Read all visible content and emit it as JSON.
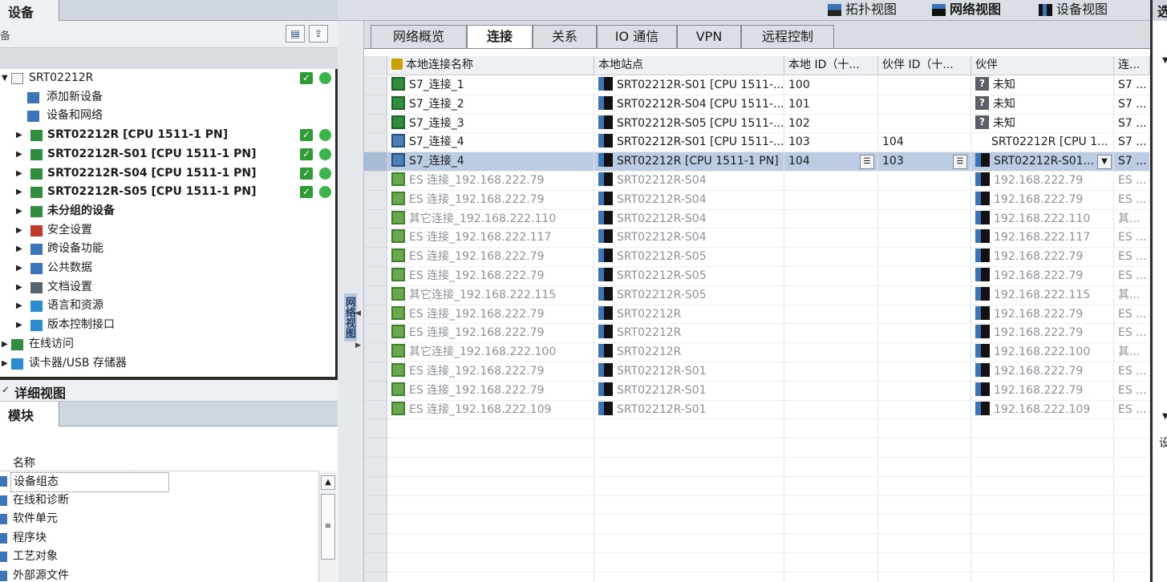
{
  "left_panel": {
    "tab_title": "设备",
    "toolbar_label": "备",
    "tree": [
      {
        "label": "SRT02212R",
        "indent": 0,
        "expanded": true,
        "bold": false,
        "status": true,
        "icon": "project-icon"
      },
      {
        "label": "添加新设备",
        "indent": 1,
        "expanded": null,
        "bold": false,
        "status": false,
        "icon": "add-device-icon"
      },
      {
        "label": "设备和网络",
        "indent": 1,
        "expanded": null,
        "bold": false,
        "status": false,
        "icon": "network-icon"
      },
      {
        "label": "SRT02212R [CPU 1511-1 PN]",
        "indent": 1,
        "expanded": false,
        "bold": true,
        "status": true,
        "icon": "plc-icon"
      },
      {
        "label": "SRT02212R-S01 [CPU 1511-1 PN]",
        "indent": 1,
        "expanded": false,
        "bold": true,
        "status": true,
        "icon": "plc-icon"
      },
      {
        "label": "SRT02212R-S04 [CPU 1511-1 PN]",
        "indent": 1,
        "expanded": false,
        "bold": true,
        "status": true,
        "icon": "plc-icon"
      },
      {
        "label": "SRT02212R-S05 [CPU 1511-1 PN]",
        "indent": 1,
        "expanded": false,
        "bold": true,
        "status": true,
        "icon": "plc-icon"
      },
      {
        "label": "未分组的设备",
        "indent": 1,
        "expanded": false,
        "bold": true,
        "status": false,
        "icon": "ungrouped-icon"
      },
      {
        "label": "安全设置",
        "indent": 1,
        "expanded": false,
        "bold": false,
        "status": false,
        "icon": "security-icon"
      },
      {
        "label": "跨设备功能",
        "indent": 1,
        "expanded": false,
        "bold": false,
        "status": false,
        "icon": "cross-device-icon"
      },
      {
        "label": "公共数据",
        "indent": 1,
        "expanded": false,
        "bold": false,
        "status": false,
        "icon": "common-data-icon"
      },
      {
        "label": "文档设置",
        "indent": 1,
        "expanded": false,
        "bold": false,
        "status": false,
        "icon": "document-icon"
      },
      {
        "label": "语言和资源",
        "indent": 1,
        "expanded": false,
        "bold": false,
        "status": false,
        "icon": "language-icon"
      },
      {
        "label": "版本控制接口",
        "indent": 1,
        "expanded": false,
        "bold": false,
        "status": false,
        "icon": "version-control-icon"
      },
      {
        "label": "在线访问",
        "indent": 0,
        "expanded": false,
        "bold": false,
        "status": false,
        "icon": "online-access-icon"
      },
      {
        "label": "读卡器/USB 存储器",
        "indent": 0,
        "expanded": false,
        "bold": false,
        "status": false,
        "icon": "card-reader-icon"
      }
    ],
    "detail_title": "详细视图",
    "detail_tab": "模块",
    "detail_column": "名称",
    "detail_rows": [
      {
        "label": "设备组态",
        "selected": true
      },
      {
        "label": "在线和诊断",
        "selected": false
      },
      {
        "label": "软件单元",
        "selected": false
      },
      {
        "label": "程序块",
        "selected": false
      },
      {
        "label": "工艺对象",
        "selected": false
      },
      {
        "label": "外部源文件",
        "selected": false
      }
    ]
  },
  "view_toolbar": {
    "topology": "拓扑视图",
    "network": "网络视图",
    "device": "设备视图"
  },
  "side_strip_label": "网络视图",
  "tabs": [
    {
      "label": "网络概览",
      "active": false
    },
    {
      "label": "连接",
      "active": true
    },
    {
      "label": "关系",
      "active": false
    },
    {
      "label": "IO 通信",
      "active": false
    },
    {
      "label": "VPN",
      "active": false
    },
    {
      "label": "远程控制",
      "active": false
    }
  ],
  "columns": [
    "本地连接名称",
    "本地站点",
    "本地 ID（十...",
    "伙伴 ID（十...",
    "伙伴",
    "连..."
  ],
  "rows": [
    {
      "name": "S7_连接_1",
      "local_station": "SRT02212R-S01 [CPU 1511-...",
      "local_id": "100",
      "partner_id": "",
      "partner": "未知",
      "conn_type": "S7 ...",
      "greyed": false,
      "selected": false,
      "icon": "s7",
      "partner_icon": "unknown"
    },
    {
      "name": "S7_连接_2",
      "local_station": "SRT02212R-S04 [CPU 1511-...",
      "local_id": "101",
      "partner_id": "",
      "partner": "未知",
      "conn_type": "S7 ...",
      "greyed": false,
      "selected": false,
      "icon": "s7",
      "partner_icon": "unknown"
    },
    {
      "name": "S7_连接_3",
      "local_station": "SRT02212R-S05 [CPU 1511-...",
      "local_id": "102",
      "partner_id": "",
      "partner": "未知",
      "conn_type": "S7 ...",
      "greyed": false,
      "selected": false,
      "icon": "s7",
      "partner_icon": "unknown"
    },
    {
      "name": "S7_连接_4",
      "local_station": "SRT02212R-S01 [CPU 1511-...",
      "local_id": "103",
      "partner_id": "104",
      "partner": "SRT02212R [CPU 1...",
      "conn_type": "S7 ...",
      "greyed": false,
      "selected": false,
      "icon": "s7vr",
      "partner_icon": "none"
    },
    {
      "name": "S7_连接_4",
      "local_station": "SRT02212R [CPU 1511-1 PN]",
      "local_id": "104",
      "partner_id": "103",
      "partner": "SRT02212R-S01...",
      "conn_type": "S7 ...",
      "greyed": false,
      "selected": true,
      "icon": "s7vr",
      "partner_icon": "cpu"
    },
    {
      "name": "ES 连接_192.168.222.79",
      "local_station": "SRT02212R-S04",
      "local_id": "",
      "partner_id": "",
      "partner": "192.168.222.79",
      "conn_type": "ES ...",
      "greyed": true,
      "selected": false,
      "icon": "es",
      "partner_icon": "cpu"
    },
    {
      "name": "ES 连接_192.168.222.79",
      "local_station": "SRT02212R-S04",
      "local_id": "",
      "partner_id": "",
      "partner": "192.168.222.79",
      "conn_type": "ES ...",
      "greyed": true,
      "selected": false,
      "icon": "es",
      "partner_icon": "cpu"
    },
    {
      "name": "其它连接_192.168.222.110",
      "local_station": "SRT02212R-S04",
      "local_id": "",
      "partner_id": "",
      "partner": "192.168.222.110",
      "conn_type": "其...",
      "greyed": true,
      "selected": false,
      "icon": "es",
      "partner_icon": "cpu"
    },
    {
      "name": "ES 连接_192.168.222.117",
      "local_station": "SRT02212R-S04",
      "local_id": "",
      "partner_id": "",
      "partner": "192.168.222.117",
      "conn_type": "ES ...",
      "greyed": true,
      "selected": false,
      "icon": "es",
      "partner_icon": "cpu"
    },
    {
      "name": "ES 连接_192.168.222.79",
      "local_station": "SRT02212R-S05",
      "local_id": "",
      "partner_id": "",
      "partner": "192.168.222.79",
      "conn_type": "ES ...",
      "greyed": true,
      "selected": false,
      "icon": "es",
      "partner_icon": "cpu"
    },
    {
      "name": "ES 连接_192.168.222.79",
      "local_station": "SRT02212R-S05",
      "local_id": "",
      "partner_id": "",
      "partner": "192.168.222.79",
      "conn_type": "ES ...",
      "greyed": true,
      "selected": false,
      "icon": "es",
      "partner_icon": "cpu"
    },
    {
      "name": "其它连接_192.168.222.115",
      "local_station": "SRT02212R-S05",
      "local_id": "",
      "partner_id": "",
      "partner": "192.168.222.115",
      "conn_type": "其...",
      "greyed": true,
      "selected": false,
      "icon": "es",
      "partner_icon": "cpu"
    },
    {
      "name": "ES 连接_192.168.222.79",
      "local_station": "SRT02212R",
      "local_id": "",
      "partner_id": "",
      "partner": "192.168.222.79",
      "conn_type": "ES ...",
      "greyed": true,
      "selected": false,
      "icon": "es",
      "partner_icon": "cpu"
    },
    {
      "name": "ES 连接_192.168.222.79",
      "local_station": "SRT02212R",
      "local_id": "",
      "partner_id": "",
      "partner": "192.168.222.79",
      "conn_type": "ES ...",
      "greyed": true,
      "selected": false,
      "icon": "es",
      "partner_icon": "cpu"
    },
    {
      "name": "其它连接_192.168.222.100",
      "local_station": "SRT02212R",
      "local_id": "",
      "partner_id": "",
      "partner": "192.168.222.100",
      "conn_type": "其...",
      "greyed": true,
      "selected": false,
      "icon": "es",
      "partner_icon": "cpu"
    },
    {
      "name": "ES 连接_192.168.222.79",
      "local_station": "SRT02212R-S01",
      "local_id": "",
      "partner_id": "",
      "partner": "192.168.222.79",
      "conn_type": "ES ...",
      "greyed": true,
      "selected": false,
      "icon": "es",
      "partner_icon": "cpu"
    },
    {
      "name": "ES 连接_192.168.222.79",
      "local_station": "SRT02212R-S01",
      "local_id": "",
      "partner_id": "",
      "partner": "192.168.222.79",
      "conn_type": "ES ...",
      "greyed": true,
      "selected": false,
      "icon": "es",
      "partner_icon": "cpu"
    },
    {
      "name": "ES 连接_192.168.222.109",
      "local_station": "SRT02212R-S01",
      "local_id": "",
      "partner_id": "",
      "partner": "192.168.222.109",
      "conn_type": "ES ...",
      "greyed": true,
      "selected": false,
      "icon": "es",
      "partner_icon": "cpu"
    }
  ],
  "right_panel": {
    "title": "选",
    "bottom_label": "设"
  }
}
